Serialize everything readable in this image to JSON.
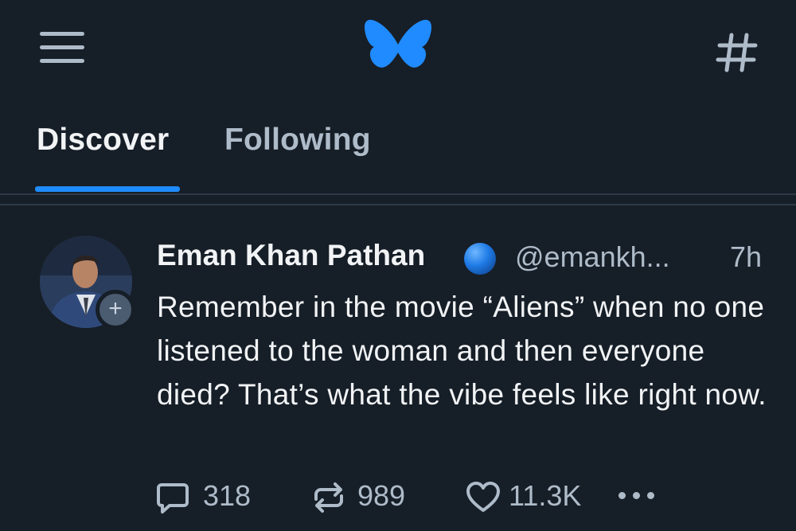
{
  "header": {
    "menu_icon": "hamburger-menu-icon",
    "logo_icon": "butterfly-logo-icon",
    "feeds_icon": "hashtag-icon",
    "brand_color": "#208bfe"
  },
  "tabs": [
    {
      "label": "Discover",
      "active": true
    },
    {
      "label": "Following",
      "active": false
    }
  ],
  "post": {
    "author_name": "Eman Khan Pathan",
    "verified_icon": "blue-circle-icon",
    "handle": "@emankh...",
    "time": "7h",
    "text": "Remember in the movie “Aliens” when no one listened to the woman and then everyone died? That’s what the vibe feels like right now.",
    "follow_label": "+",
    "actions": {
      "replies": "318",
      "reposts": "989",
      "likes": "11.3K"
    }
  }
}
